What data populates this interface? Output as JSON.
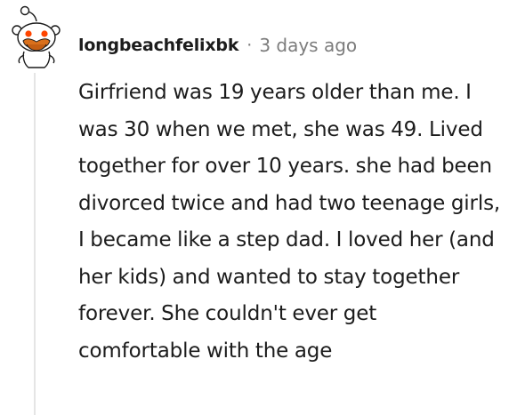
{
  "comment": {
    "username": "longbeachfelixbk",
    "separator": "·",
    "timestamp": "3 days ago",
    "body": "Girfriend was 19 years older than me. I was 30 when we met, she was 49. Lived together for over 10 years. she had been divorced twice and had two teenage girls, I became like a step dad. I loved her (and her kids) and wanted to stay together forever. She couldn't ever get comfortable with the age",
    "avatar_icon": "snoo-avatar-icon"
  },
  "colors": {
    "text": "#1c1c1c",
    "meta": "#7c7c7c",
    "thread_line": "#e5e5e5",
    "avatar_accent": "#ff4500"
  }
}
